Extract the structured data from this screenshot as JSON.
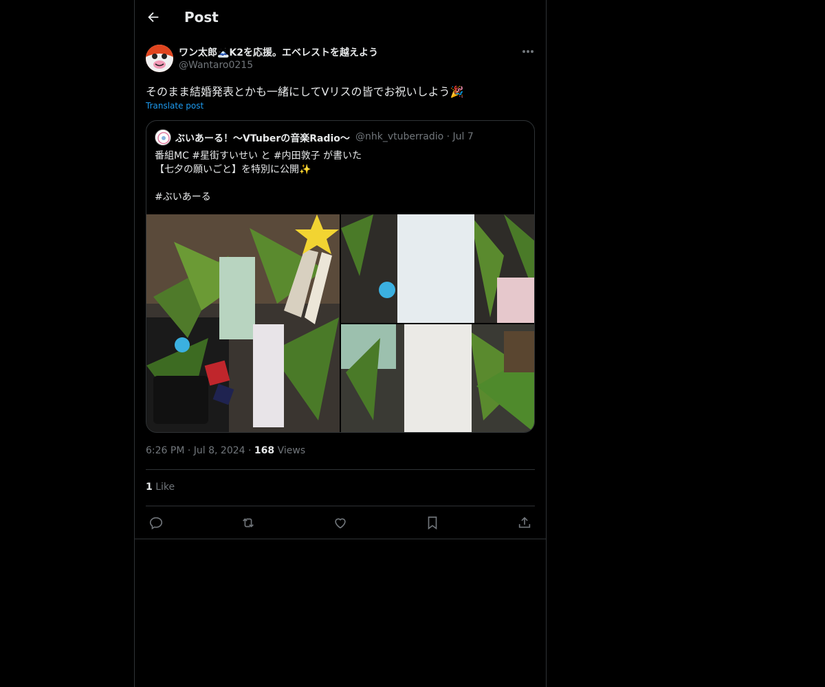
{
  "header": {
    "title": "Post"
  },
  "post": {
    "author_name": "ワン太郎🗻K2を応援。エベレストを越えよう",
    "author_handle": "@Wantaro0215",
    "text": "そのまま結婚発表とかも一緒にしてVリスの皆でお祝いしよう🎉",
    "translate_label": "Translate post",
    "time": "6:26 PM",
    "date": "Jul 8, 2024",
    "views_count": "168",
    "views_label": "Views",
    "likes_count": "1",
    "likes_label": "Like"
  },
  "quote": {
    "name": "ぶいあーる！〜VTuberの音楽Radio〜",
    "handle": "@nhk_vtuberradio",
    "date": "Jul 7",
    "lines": [
      "番組MC #星街すいせい と #内田敦子 が書いた",
      "【七夕の願いごと】を特別に公開✨",
      "",
      "#ぶいあーる"
    ]
  },
  "colors": {
    "background": "#000000",
    "text": "#e7e9ea",
    "muted": "#71767b",
    "link": "#1d9bf0",
    "border": "#2f3336"
  }
}
